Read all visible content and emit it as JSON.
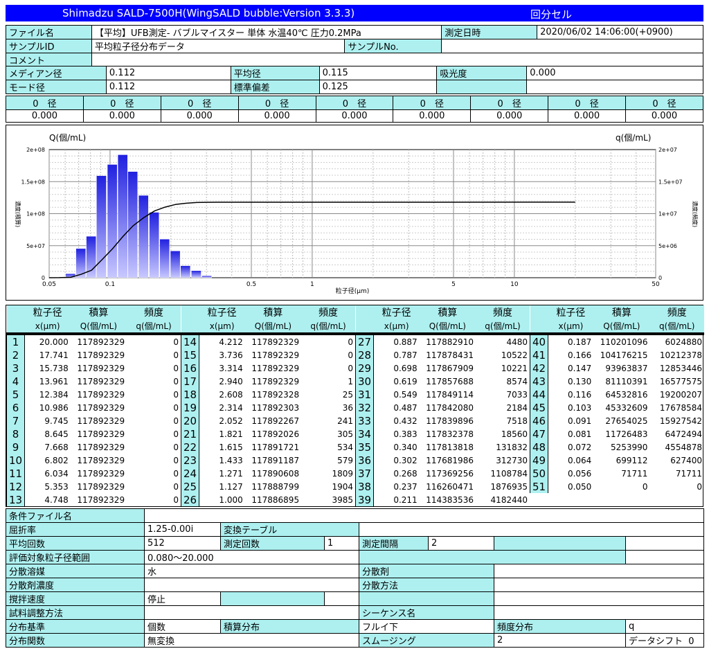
{
  "window": {
    "title": "Shimadzu SALD-7500H(WingSALD bubble:Version 3.3.3)",
    "cell_type": "回分セル"
  },
  "info": {
    "file_name_label": "ファイル名",
    "file_name": "【平均】UFB測定- バブルマイスター 単体 水温40℃ 圧力0.2MPa",
    "date_label": "測定日時",
    "date": "2020/06/02 14:06:00(+0900)",
    "sample_id_label": "サンプルID",
    "sample_id": "平均粒子径分布データ",
    "sample_no_label": "サンプルNo.",
    "sample_no": "",
    "comment_label": "コメント",
    "comment": "",
    "median_label": "メディアン径",
    "median": "0.112",
    "mean_label": "平均径",
    "mean": "0.115",
    "absorbance_label": "吸光度",
    "absorbance": "0.000",
    "mode_label": "モード径",
    "mode": "0.112",
    "std_label": "標準偏差",
    "std": "0.125"
  },
  "diam": {
    "headers": [
      "0　径",
      "0　径",
      "0　径",
      "0　径",
      "0　径",
      "0　径",
      "0　径",
      "0　径",
      "0　径"
    ],
    "values": [
      "0.000",
      "0.000",
      "0.000",
      "0.000",
      "0.000",
      "0.000",
      "0.000",
      "0.000",
      "0.000"
    ]
  },
  "chart_data": {
    "type": "bar",
    "title": "",
    "left_axis_label": "Q(個/mL)",
    "right_axis_label": "q(個/mL)",
    "left_side_label": "濃度(積算)",
    "right_side_label": "濃度(頻度)",
    "xlabel": "粒子径(μm)",
    "xscale": "log",
    "xlim": [
      0.05,
      50
    ],
    "x_ticks": [
      "0.05",
      "0.1",
      "0.5",
      "1",
      "5",
      "10",
      "50"
    ],
    "left_ylim": [
      0,
      200000000
    ],
    "left_ticks": [
      "0",
      "5e+07",
      "1e+08",
      "1.5e+08",
      "2e+08"
    ],
    "right_ylim": [
      0,
      20000000
    ],
    "right_ticks": [
      "0",
      "5e+06",
      "1e+07",
      "1.5e+07",
      "2e+07"
    ],
    "grid": true,
    "bar_color": "#2020e0",
    "line_color": "#000000",
    "series": [
      {
        "name": "頻度分布",
        "kind": "bar",
        "x": [
          0.056,
          0.064,
          0.072,
          0.081,
          0.091,
          0.103,
          0.116,
          0.13,
          0.147,
          0.166,
          0.187,
          0.211,
          0.237,
          0.268,
          0.302
        ],
        "y": [
          71711,
          627400,
          4554878,
          6472494,
          15927542,
          17678584,
          19200207,
          16577575,
          12853446,
          10212378,
          6024880,
          4182440,
          1876935,
          1108784,
          312730
        ]
      },
      {
        "name": "積算分布",
        "kind": "line",
        "x": [
          0.05,
          0.056,
          0.064,
          0.072,
          0.081,
          0.091,
          0.103,
          0.116,
          0.13,
          0.147,
          0.166,
          0.187,
          0.211,
          0.237,
          0.268,
          0.302,
          0.34,
          0.432,
          1.0,
          20.0
        ],
        "y": [
          0,
          71711,
          699112,
          5253990,
          11726483,
          27654025,
          45332609,
          64532816,
          81110391,
          93963837,
          104176215,
          110201096,
          114383536,
          116260471,
          117369256,
          117681986,
          117813818,
          117839896,
          117886895,
          117892329
        ]
      }
    ]
  },
  "table": {
    "head1": [
      "粒子径",
      "積算",
      "頻度"
    ],
    "head2": [
      "x(μm)",
      "Q(個/mL)",
      "q(個/mL)"
    ],
    "rows": [
      [
        "1",
        "20.000",
        "117892329",
        "0"
      ],
      [
        "2",
        "17.741",
        "117892329",
        "0"
      ],
      [
        "3",
        "15.738",
        "117892329",
        "0"
      ],
      [
        "4",
        "13.961",
        "117892329",
        "0"
      ],
      [
        "5",
        "12.384",
        "117892329",
        "0"
      ],
      [
        "6",
        "10.986",
        "117892329",
        "0"
      ],
      [
        "7",
        "9.745",
        "117892329",
        "0"
      ],
      [
        "8",
        "8.645",
        "117892329",
        "0"
      ],
      [
        "9",
        "7.668",
        "117892329",
        "0"
      ],
      [
        "10",
        "6.802",
        "117892329",
        "0"
      ],
      [
        "11",
        "6.034",
        "117892329",
        "0"
      ],
      [
        "12",
        "5.353",
        "117892329",
        "0"
      ],
      [
        "13",
        "4.748",
        "117892329",
        "0"
      ],
      [
        "14",
        "4.212",
        "117892329",
        "0"
      ],
      [
        "15",
        "3.736",
        "117892329",
        "0"
      ],
      [
        "16",
        "3.314",
        "117892329",
        "0"
      ],
      [
        "17",
        "2.940",
        "117892329",
        "1"
      ],
      [
        "18",
        "2.608",
        "117892328",
        "25"
      ],
      [
        "19",
        "2.314",
        "117892303",
        "36"
      ],
      [
        "20",
        "2.052",
        "117892267",
        "241"
      ],
      [
        "21",
        "1.821",
        "117892026",
        "305"
      ],
      [
        "22",
        "1.615",
        "117891721",
        "534"
      ],
      [
        "23",
        "1.433",
        "117891187",
        "579"
      ],
      [
        "24",
        "1.271",
        "117890608",
        "1809"
      ],
      [
        "25",
        "1.127",
        "117888799",
        "1904"
      ],
      [
        "26",
        "1.000",
        "117886895",
        "3985"
      ],
      [
        "27",
        "0.887",
        "117882910",
        "4480"
      ],
      [
        "28",
        "0.787",
        "117878431",
        "10522"
      ],
      [
        "29",
        "0.698",
        "117867909",
        "10221"
      ],
      [
        "30",
        "0.619",
        "117857688",
        "8574"
      ],
      [
        "31",
        "0.549",
        "117849114",
        "7033"
      ],
      [
        "32",
        "0.487",
        "117842080",
        "2184"
      ],
      [
        "33",
        "0.432",
        "117839896",
        "7518"
      ],
      [
        "34",
        "0.383",
        "117832378",
        "18560"
      ],
      [
        "35",
        "0.340",
        "117813818",
        "131832"
      ],
      [
        "36",
        "0.302",
        "117681986",
        "312730"
      ],
      [
        "37",
        "0.268",
        "117369256",
        "1108784"
      ],
      [
        "38",
        "0.237",
        "116260471",
        "1876935"
      ],
      [
        "39",
        "0.211",
        "114383536",
        "4182440"
      ],
      [
        "40",
        "0.187",
        "110201096",
        "6024880"
      ],
      [
        "41",
        "0.166",
        "104176215",
        "10212378"
      ],
      [
        "42",
        "0.147",
        "93963837",
        "12853446"
      ],
      [
        "43",
        "0.130",
        "81110391",
        "16577575"
      ],
      [
        "44",
        "0.116",
        "64532816",
        "19200207"
      ],
      [
        "45",
        "0.103",
        "45332609",
        "17678584"
      ],
      [
        "46",
        "0.091",
        "27654025",
        "15927542"
      ],
      [
        "47",
        "0.081",
        "11726483",
        "6472494"
      ],
      [
        "48",
        "0.072",
        "5253990",
        "4554878"
      ],
      [
        "49",
        "0.064",
        "699112",
        "627400"
      ],
      [
        "50",
        "0.056",
        "71711",
        "71711"
      ],
      [
        "51",
        "0.050",
        "0",
        "0"
      ]
    ]
  },
  "conditions": {
    "cond_file_label": "条件ファイル名",
    "cond_file": "",
    "refr_label": "屈折率",
    "refr": "1.25-0.00i",
    "conv_label": "変換テーブル",
    "conv": "",
    "avg_label": "平均回数",
    "avg": "512",
    "meas_count_label": "測定回数",
    "meas_count": "1",
    "interval_label": "測定間隔",
    "interval": "2",
    "range_label": "評価対象粒子径範囲",
    "range": "0.080～20.000",
    "solvent_label": "分散溶媒",
    "solvent": "水",
    "dispersant_label": "分散剤",
    "dispersant": "",
    "disp_conc_label": "分散剤濃度",
    "disp_conc": "",
    "disp_method_label": "分散方法",
    "disp_method": "",
    "stir_label": "撹拌速度",
    "stir": "停止",
    "prep_label": "試料調整方法",
    "prep": "",
    "seq_label": "シーケンス名",
    "seq": "",
    "basis_label": "分布基準",
    "basis": "個数",
    "cum_label": "積算分布",
    "cum": "フルイ下",
    "freq_label": "頻度分布",
    "freq": "q",
    "func_label": "分布関数",
    "func": "無変換",
    "smooth_label": "スムージング",
    "smooth": "2",
    "shift_label": "データシフト",
    "shift": "0"
  }
}
